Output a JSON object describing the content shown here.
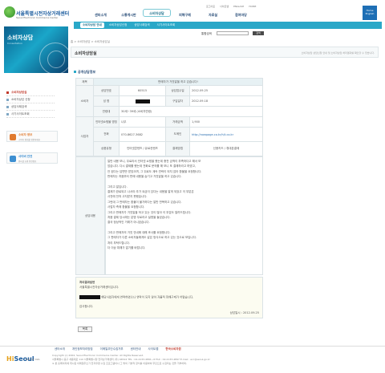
{
  "util": {
    "links": [
      "로그아웃",
      "사이트맵",
      "ENGLISH",
      "HOME"
    ]
  },
  "logo": {
    "ko": "서울특별시전자상거래센터",
    "en": "Seoul Electronic Commerce Center"
  },
  "gnb": [
    "센터소개",
    "소통게시판",
    "소비자상담",
    "피해구제",
    "자료실",
    "참여마당"
  ],
  "home": {
    "line1": "Home",
    "line2": "English"
  },
  "subnav": [
    "소비자상담 안내",
    "소비자상담신청",
    "상담사례검색",
    "사기사이트조회"
  ],
  "banner": {
    "title": "소비자상담",
    "subtitle": "Consultation"
  },
  "search": {
    "label": "통합검색",
    "placeholder": "",
    "button": "검색"
  },
  "breadcrumb": "홈 > 소비자상담 > 소비자상담실",
  "page": {
    "title": "소비자상담실",
    "desc": "소비자상담 상담신청 안내 및 소비자상담 처리결과를 확인할 수 있습니다."
  },
  "lnb": [
    "소비자상담실",
    "소비자상담 신청",
    "상담사례검색",
    "사기사이트조회"
  ],
  "quick": [
    {
      "title": "소비자 정보",
      "sub": "소비자 정보를 확인하세요"
    },
    {
      "title": "사이버 안전",
      "sub": "인터넷 쇼핑 안전정보"
    }
  ],
  "section": "공개상담정보",
  "detail": {
    "bar_head": "제목",
    "bar_title": "판매자가 거짓말을 하고 있습니다!",
    "consumer": "소비자",
    "seller": "사업자",
    "content_head": "상담내용",
    "rows": {
      "consult_no_label": "상담번호",
      "consult_no": "60515",
      "consult_date_label": "상담접수일",
      "consult_date": "2012.09.25",
      "name_label": "성 명",
      "purchase_date_label": "구입일자",
      "purchase_date": "2012.09.18",
      "age_label": "연령대",
      "age": "30세~39세 (소비자연령)",
      "biz_name_label": "인터넷쇼핑몰 명칭",
      "biz_name": "나우",
      "price_label": "거래금액",
      "price": "1,900",
      "phone_label": "전화",
      "phone": "070-8627-3682",
      "domain_label": "도메인",
      "domain": "http://nowpage.co.kr/h/t.co.kr",
      "type_label": "상품유형",
      "type": "인터넷콘텐츠 / 유료컨텐츠",
      "payment_label": "결제방법",
      "payment": "신용카드 / 휴대폰결제"
    }
  },
  "content_lines": [
    "일반 내용 보니, 무료라서 인터넷 쇼핑을 했는데 충전 금액이 부족하다고 해서 보",
    "았습니다. 다시 결제를 했는데 전화로 문의를 해 보니 또 결제하라고 하였고,",
    "안 된다는 답변만 받았으며, 그 뒤로도 계속 연락이 되지 않아 환불을 요청합니다.",
    "판매자는 처음부터 판매 내용을 숨기고 거짓말을 하고 있습니다.",
    "",
    "그리고 말입니다.",
    "결제가 완료되고 나서야 추가 요금이 있다는 내용을 알게 되었고 이 부분은",
    "사전에 전혀 고지받지 못했습니다.",
    "그런데 그 판매자는 환불이 불가하다는 말만 반복하고 있습니다.",
    "사업자 측에 환불을 요청합니다.",
    "그리고 판매자가 거짓말을 하고 있는 것이 많아 이 부분도 알려드립니다.",
    "처음 결제 당시에는 분명 무료라고 설명을 들었습니다.",
    "결국 정상적인 거래가 아니었습니다.",
    "",
    "그리고 판매자의 거짓 안내에 대해 조사를 요청합니다.",
    "그 판매자가 다른 소비자들에게도 같은 방식으로 하고 있는 것으로 보입니다.",
    "처리 부탁드립니다.",
    "더 이상 피해가 없기를 바랍니다."
  ],
  "answer": {
    "head": "처리결과답변",
    "line1": "서울특별시전자상거래센터입니다.",
    "line2": "해당사업자에게 연락하였으나 연락이 되지 않아 자율적 피해구제가 어렵습니다.",
    "line3": "감사합니다.",
    "date": "상담일시 : 2012.09.25"
  },
  "list_button": "목록",
  "footer": {
    "links": [
      "센터소개",
      "개인정보처리방침",
      "이메일무단수집거부",
      "센터안내",
      "사이트맵",
      "한국소비자원"
    ],
    "logo_a": "Hi",
    "logo_b": "Seoul",
    "logo_sub": "SOUL OF ASIA",
    "copyright": "Copyright (c) 2004, Seoul Electronic Commerce Center. All Rights Reserved.",
    "address": "서울특별시 중구 세종대로 110 서울특별시청 전자상거래센터 (우) 04524  TEL : 02-2133-4891~6  FAX : 02-2133-4897  E-mail : ecc@seoul.go.kr",
    "notice": "※ 본 홈페이지에 게시된 이메일주소가 전자우편 수집 프로그램이나 그 밖의 기술적 장치를 이용하여 무단으로 수집되는 것을 거부하며,"
  }
}
